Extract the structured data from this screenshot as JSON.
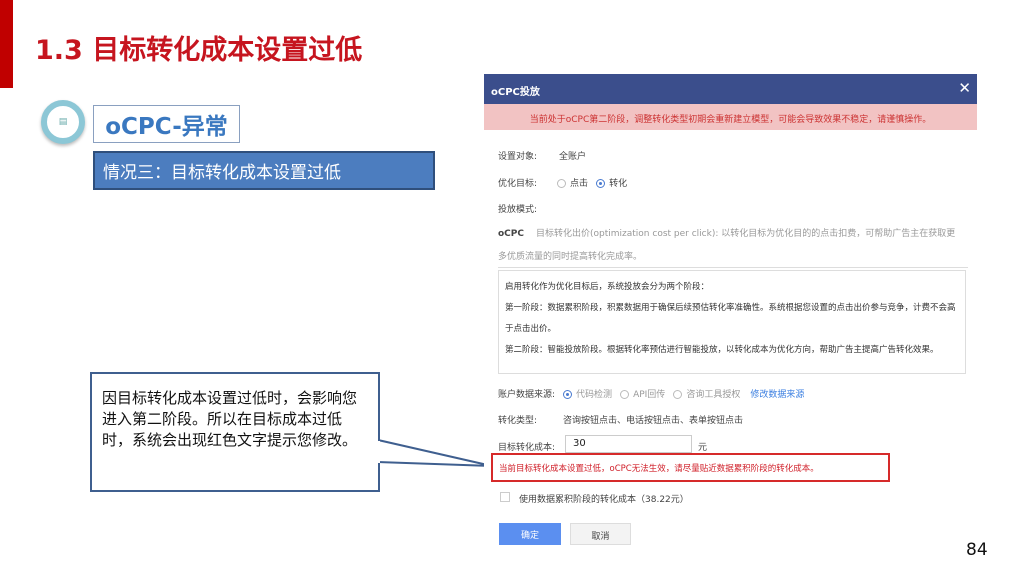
{
  "slide": {
    "title": "1.3  目标转化成本设置过低",
    "section_label": "oCPC-异常",
    "case_label": "情况三：目标转化成本设置过低",
    "callout": "因目标转化成本设置过低时，会影响您进入第二阶段。所以在目标成本过低时，系统会出现红色文字提示您修改。",
    "page_number": "84",
    "accent_color": "#c6151f",
    "blue_color": "#4c7dbf"
  },
  "dialog": {
    "title": "oCPC投放",
    "close": "✕",
    "warning": "当前处于oCPC第二阶段，调整转化类型初期会重新建立模型，可能会导致效果不稳定，请谨慎操作。",
    "target_label": "设置对象:",
    "target_value": "全账户",
    "goal_label": "优化目标:",
    "goal_options": [
      "点击",
      "转化"
    ],
    "goal_selected": "转化",
    "mode_label": "投放模式:",
    "ocpc_tag": "oCPC",
    "ocpc_desc_1": "目标转化出价(optimization cost per click): 以转化目标为优化目的的点击扣费，可帮助广告主在获取更",
    "ocpc_desc_2": "多优质流量的同时提高转化完成率。",
    "stages": [
      "启用转化作为优化目标后，系统投放会分为两个阶段：",
      "第一阶段：数据累积阶段，积累数据用于确保后续预估转化率准确性。系统根据您设置的点击出价参与竞争，计费不会高于点击出价。",
      "第二阶段：智能投放阶段。根据转化率预估进行智能投放，以转化成本为优化方向，帮助广告主提高广告转化效果。"
    ],
    "source_label": "账户数据来源:",
    "source_options": [
      "代码检测",
      "API回传",
      "咨询工具授权"
    ],
    "source_link": "修改数据来源",
    "conv_type_label": "转化类型:",
    "conv_type_value": "咨询按钮点击、电话按钮点击、表单按钮点击",
    "cost_label": "目标转化成本:",
    "cost_value": "30",
    "cost_unit": "元",
    "error": "当前目标转化成本设置过低，oCPC无法生效，请尽量贴近数据累积阶段的转化成本。",
    "checkbox_label": "使用数据累积阶段的转化成本（38.22元）",
    "ok": "确定",
    "cancel": "取消"
  }
}
